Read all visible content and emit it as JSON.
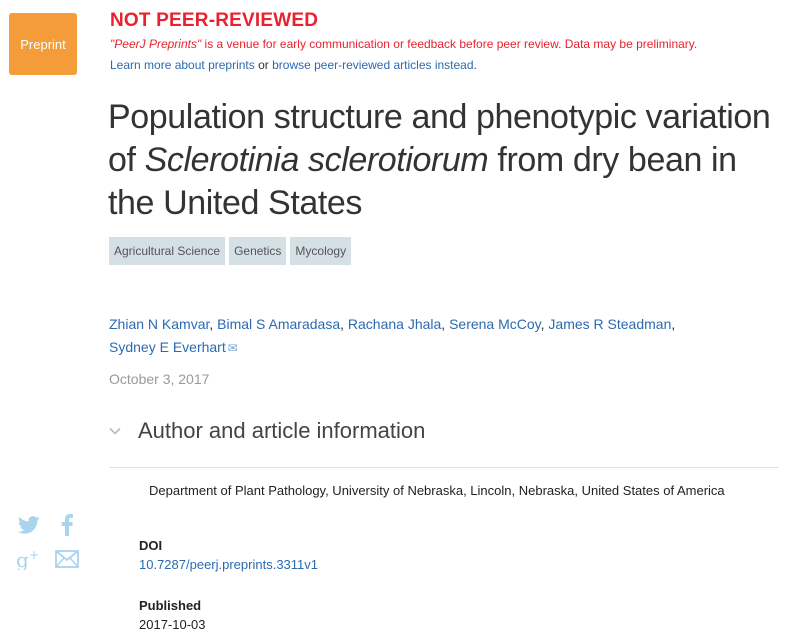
{
  "badge": {
    "label": "Preprint"
  },
  "notice": {
    "title": "NOT PEER-REVIEWED",
    "desc_venue": "\"PeerJ Preprints\"",
    "desc_rest": " is a venue for early communication or feedback before peer review. Data may be preliminary.",
    "link_learn": "Learn more about preprints",
    "link_sep": " or ",
    "link_browse": "browse peer-reviewed articles instead",
    "link_end": "."
  },
  "article": {
    "title_part1": "Population structure and phenotypic variation of ",
    "title_italic": "Sclerotinia sclerotiorum",
    "title_part2": " from dry bean in the United States",
    "tags": [
      "Agricultural Science",
      "Genetics",
      "Mycology"
    ],
    "authors": [
      "Zhian N Kamvar",
      "Bimal S Amaradasa",
      "Rachana Jhala",
      "Serena McCoy",
      "James R Steadman",
      "Sydney E Everhart"
    ],
    "author_sep": ", ",
    "date": "October 3, 2017"
  },
  "author_info": {
    "toggle_label": "Author and article information",
    "affiliation": "Department of Plant Pathology, University of Nebraska, Lincoln, Nebraska, United States of America",
    "doi_label": "DOI",
    "doi_value": "10.7287/peerj.preprints.3311v1",
    "published_label": "Published",
    "published_value": "2017-10-03"
  },
  "social": {
    "icons": [
      "twitter-icon",
      "facebook-icon",
      "google-plus-icon",
      "email-icon"
    ],
    "color": "#a9d4ee"
  },
  "colors": {
    "accent_red": "#e8222e",
    "link_blue": "#2d6ab0",
    "badge_orange": "#f39c39",
    "tag_bg": "#d5dfe6"
  }
}
